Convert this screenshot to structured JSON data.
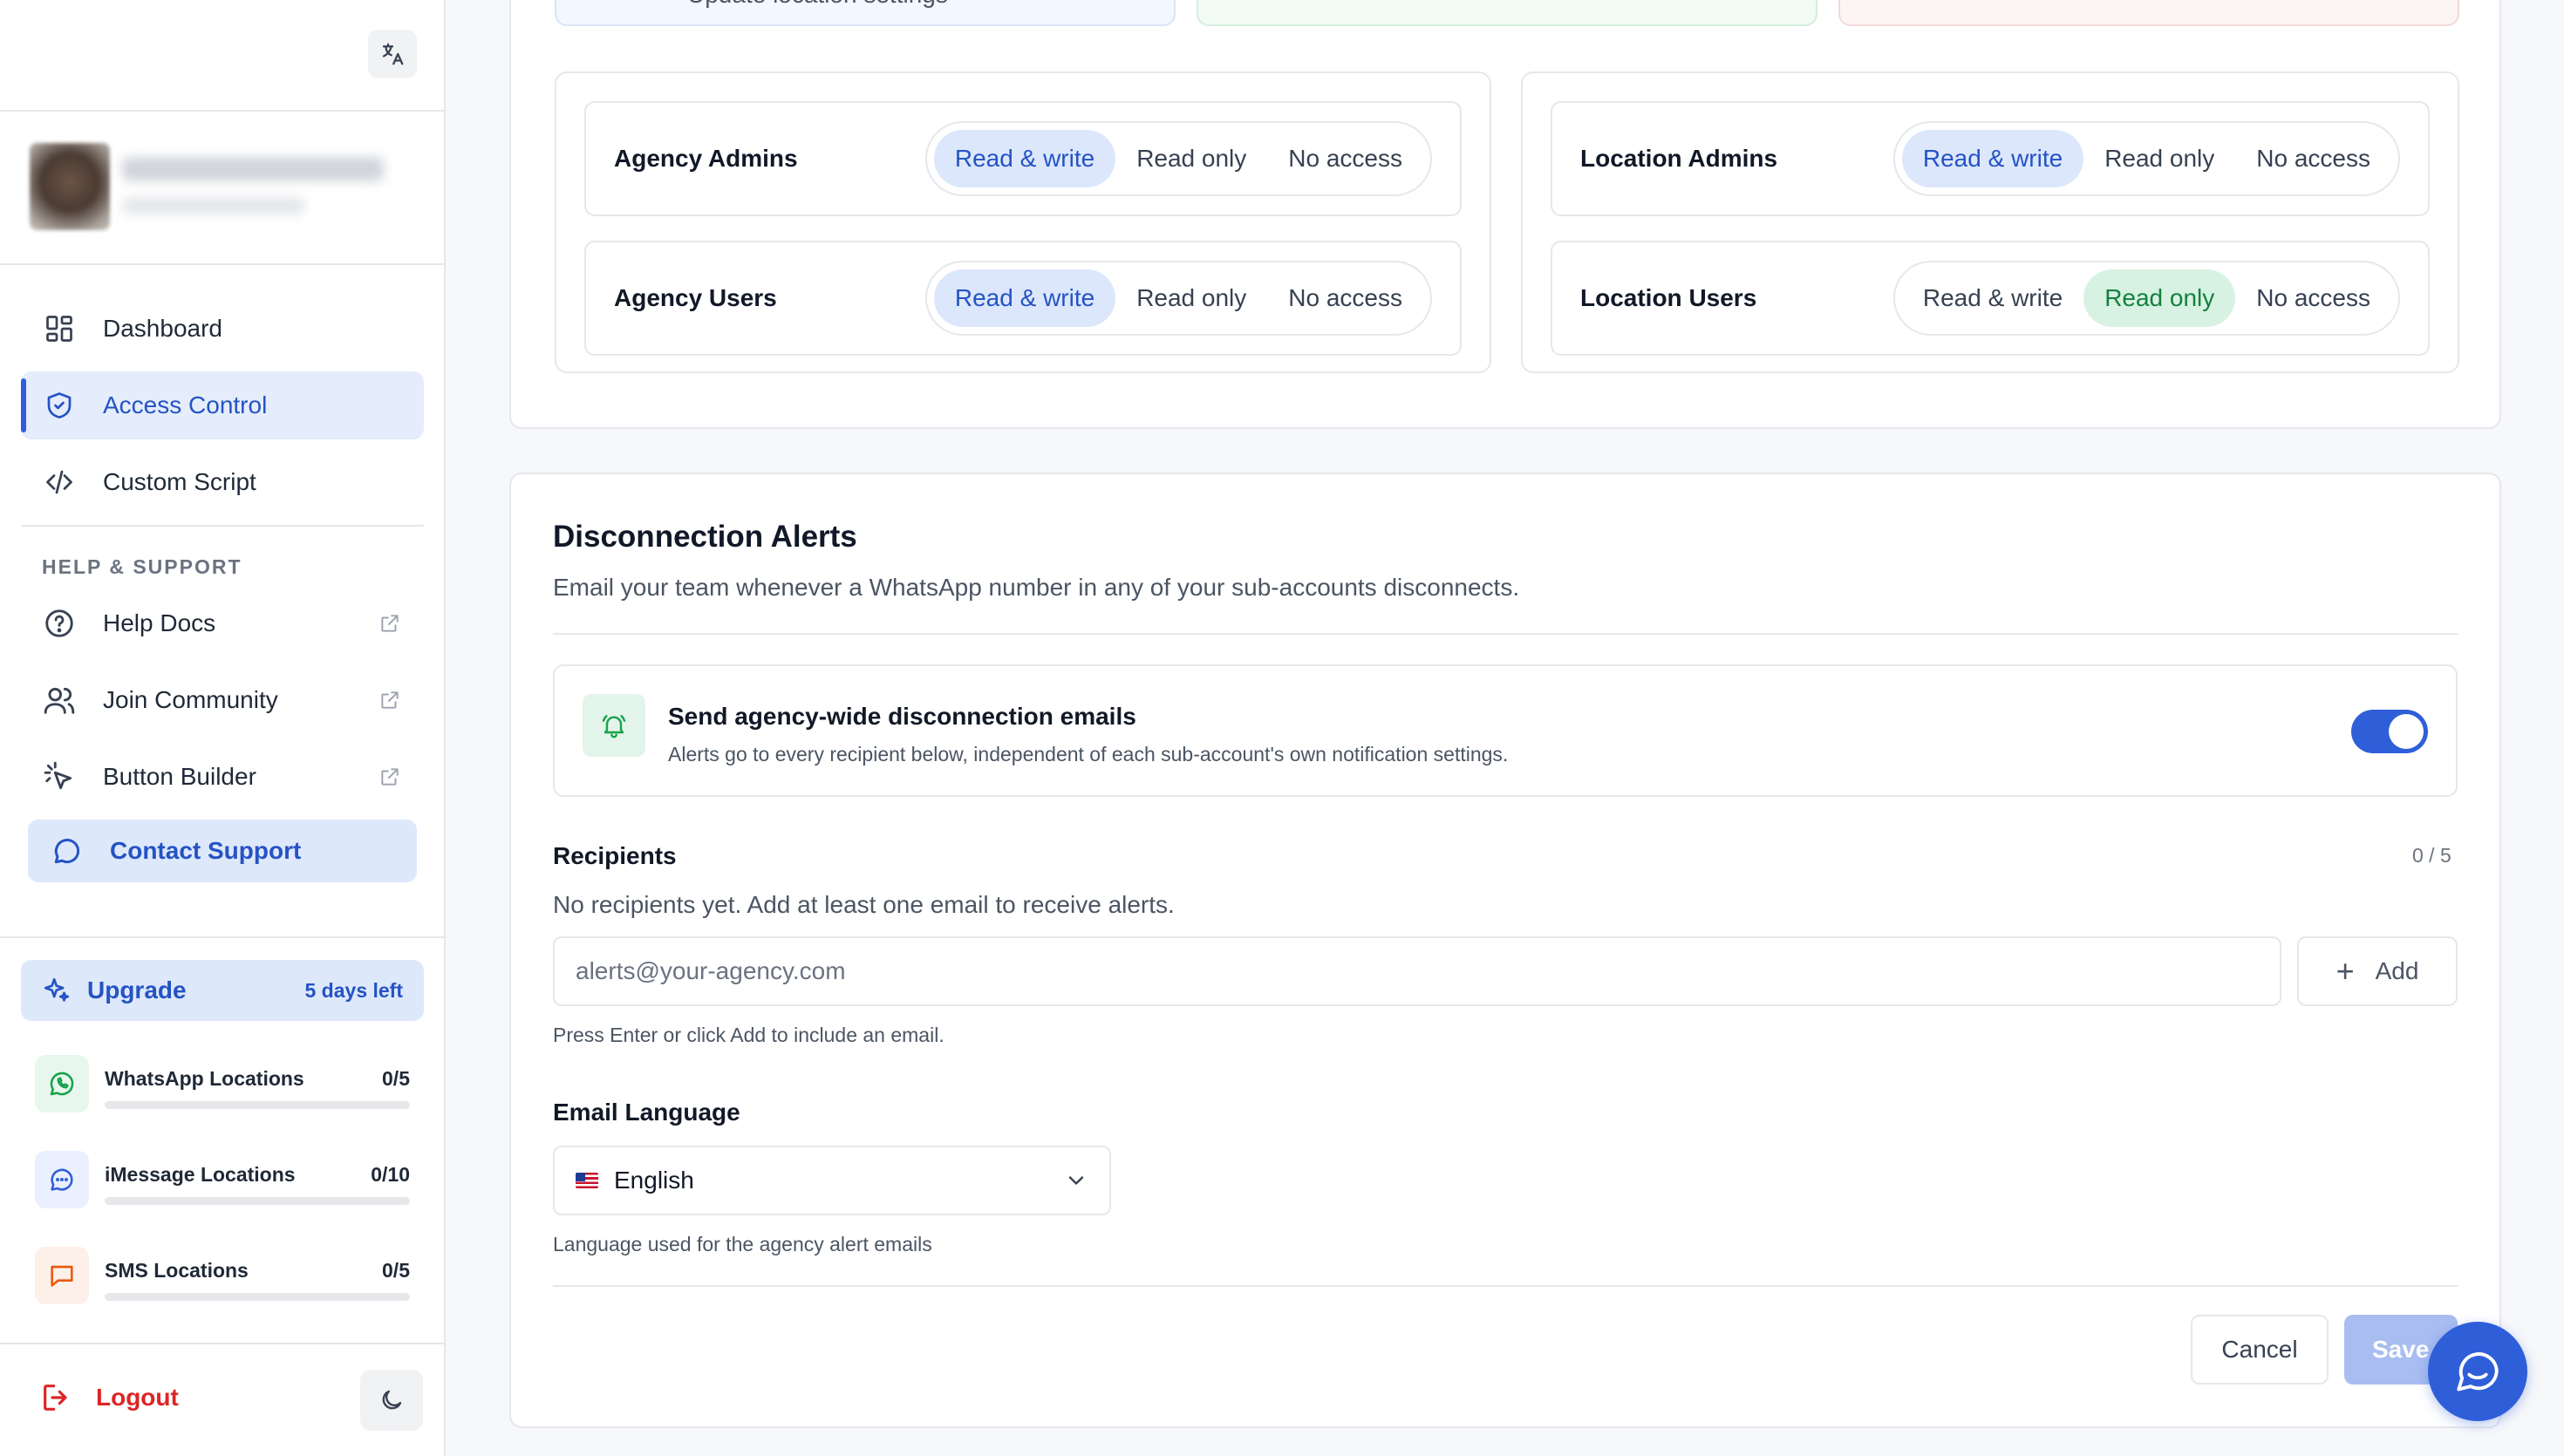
{
  "sidebar": {
    "nav": [
      {
        "label": "Dashboard",
        "icon": "dashboard-icon"
      },
      {
        "label": "Access Control",
        "icon": "shield-icon",
        "active": true
      },
      {
        "label": "Custom Script",
        "icon": "code-icon"
      }
    ],
    "help_section_label": "HELP & SUPPORT",
    "help_items": [
      {
        "label": "Help Docs",
        "icon": "help-circle-icon"
      },
      {
        "label": "Join Community",
        "icon": "users-icon"
      },
      {
        "label": "Button Builder",
        "icon": "pointer-icon"
      }
    ],
    "contact_support": "Contact Support",
    "upgrade": {
      "label": "Upgrade",
      "days_left": "5 days left"
    },
    "usage": [
      {
        "label": "WhatsApp Locations",
        "count": "0/5",
        "used": 0,
        "limit": 5,
        "color": "#16a34a"
      },
      {
        "label": "iMessage Locations",
        "count": "0/10",
        "used": 0,
        "limit": 10,
        "color": "#2f5fd8"
      },
      {
        "label": "SMS Locations",
        "count": "0/5",
        "used": 0,
        "limit": 5,
        "color": "#ea580c"
      }
    ],
    "logout": "Logout"
  },
  "top_card_partial_text": "Update location settings",
  "permissions": {
    "options": [
      "Read & write",
      "Read only",
      "No access"
    ],
    "agency": [
      {
        "role": "Agency Admins",
        "selected": "Read & write"
      },
      {
        "role": "Agency Users",
        "selected": "Read & write"
      }
    ],
    "location": [
      {
        "role": "Location Admins",
        "selected": "Read & write"
      },
      {
        "role": "Location Users",
        "selected": "Read only"
      }
    ]
  },
  "alerts": {
    "title": "Disconnection Alerts",
    "subtitle": "Email your team whenever a WhatsApp number in any of your sub-accounts disconnects.",
    "toggle_title": "Send agency-wide disconnection emails",
    "toggle_desc": "Alerts go to every recipient below, independent of each sub-account's own notification settings.",
    "toggle_on": true,
    "recipients_label": "Recipients",
    "recipients_count": "0 / 5",
    "recipients_empty": "No recipients yet. Add at least one email to receive alerts.",
    "email_placeholder": "alerts@your-agency.com",
    "add_label": "Add",
    "email_hint": "Press Enter or click Add to include an email.",
    "language_label": "Email Language",
    "language_value": "English",
    "language_hint": "Language used for the agency alert emails",
    "cancel_label": "Cancel",
    "save_label": "Save"
  },
  "colors": {
    "accent": "#2f5fd8",
    "accent_soft": "#dce7fb",
    "success_soft": "#d7f2e2",
    "danger": "#dc2626"
  }
}
